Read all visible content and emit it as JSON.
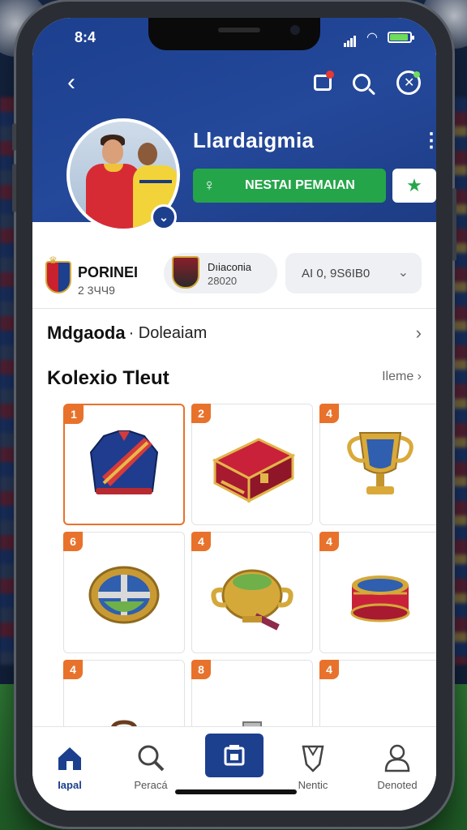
{
  "status": {
    "time": "8:4"
  },
  "profile": {
    "username": "Llardaigmia",
    "follow_label": "NESTAI PEMAIAN"
  },
  "clubs": [
    {
      "name": "PORINEI",
      "sub": "2 3ЧЧ9"
    },
    {
      "name": "Dıiаcoпia",
      "sub": "28020"
    }
  ],
  "club_select": {
    "value": "AI 0, 9S6IB0"
  },
  "sections": {
    "row1_title": "Mdgaoda",
    "row1_sub": "· Doleaiam",
    "collection_title": "Kolexio Tleut",
    "see_all": "Ileme"
  },
  "collection": [
    {
      "badge": "1",
      "icon": "jacket-icon",
      "selected": true
    },
    {
      "badge": "2",
      "icon": "chest-icon"
    },
    {
      "badge": "4",
      "icon": "trophy-icon"
    },
    {
      "badge": "6",
      "icon": "medallion-icon"
    },
    {
      "badge": "4",
      "icon": "urn-icon"
    },
    {
      "badge": "4",
      "icon": "drum-icon"
    },
    {
      "badge": "4",
      "icon": "bag-icon"
    },
    {
      "badge": "8",
      "icon": "flask-icon"
    },
    {
      "badge": "4",
      "icon": "treasure-box-icon"
    }
  ],
  "nav": [
    {
      "label": "Iapal",
      "icon": "home-icon",
      "active": true
    },
    {
      "label": "Peracá",
      "icon": "search-icon"
    },
    {
      "label": "",
      "icon": "store-icon"
    },
    {
      "label": "Nentic",
      "icon": "shield-icon"
    },
    {
      "label": "Denoted",
      "icon": "profile-icon"
    }
  ],
  "colors": {
    "header_blue": "#1c3f8e",
    "follow_green": "#25a54a",
    "badge_orange": "#e8722b"
  }
}
